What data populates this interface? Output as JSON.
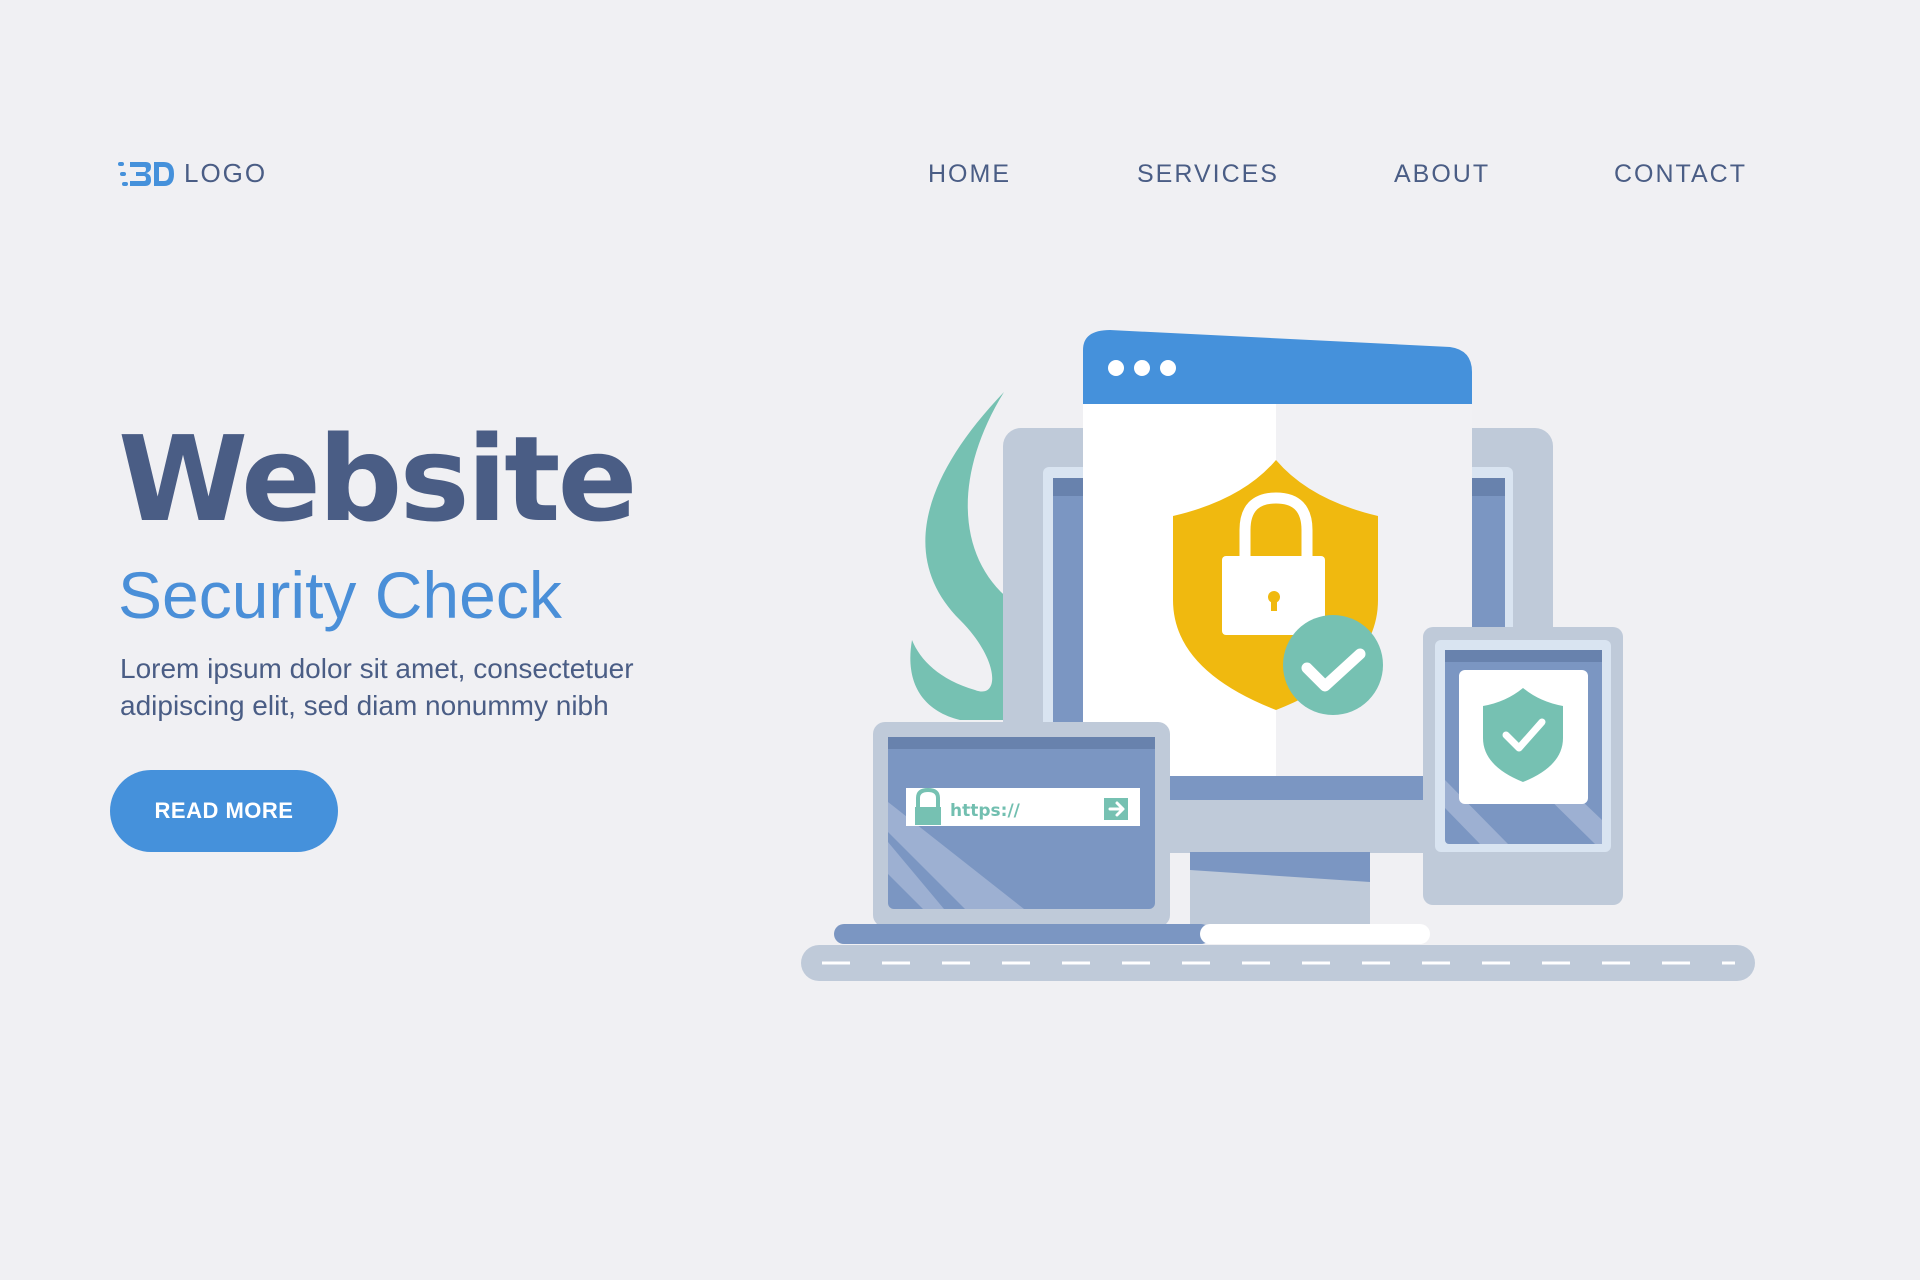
{
  "header": {
    "logo": {
      "icon": "logo-3d-mark-icon",
      "text": "LOGO"
    },
    "nav": [
      {
        "label": "HOME"
      },
      {
        "label": "SERVICES"
      },
      {
        "label": "ABOUT"
      },
      {
        "label": "CONTACT"
      }
    ]
  },
  "hero": {
    "title": "Website",
    "subtitle": "Security Check",
    "body": "Lorem ipsum dolor sit amet, consectetuer adipiscing elit, sed diam nonummy nibh",
    "button_label": "READ MORE"
  },
  "illustration": {
    "url_text": "https://",
    "icons": [
      "shield-lock-icon",
      "checkmark-badge-icon",
      "phone-shield-check-icon",
      "padlock-icon",
      "arrow-right-icon",
      "leaf-plant-icon"
    ]
  },
  "colors": {
    "background": "#f0f0f3",
    "navy_text": "#4a5d85",
    "accent_blue": "#4591db",
    "shield_yellow": "#f0b90f",
    "check_green": "#76c1b2",
    "device_grey": "#bfcad9",
    "screen_blue": "#7b96c2"
  }
}
